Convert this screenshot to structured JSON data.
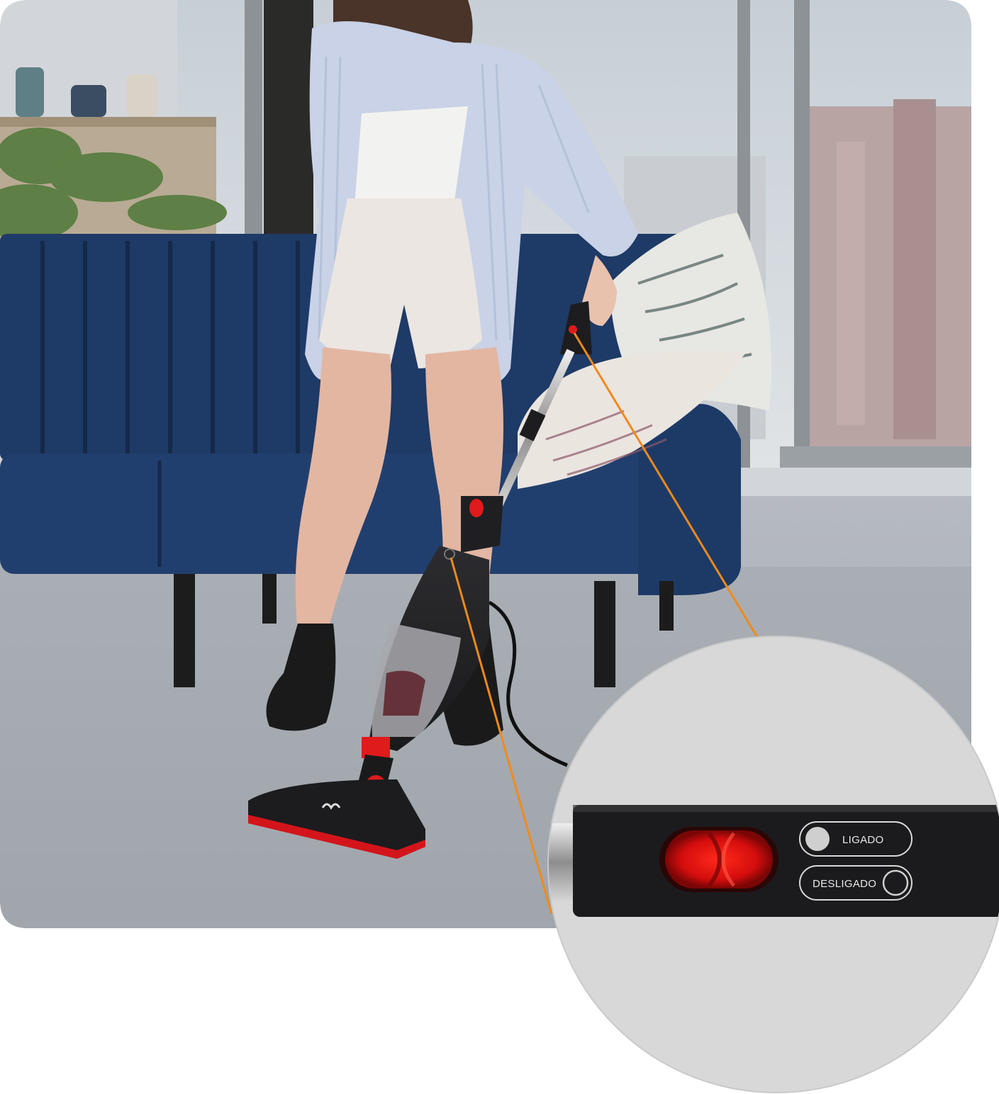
{
  "switch_panel": {
    "on_label": "LIGADO",
    "off_label": "DESLIGADO"
  },
  "colors": {
    "accent_red": "#e01b1b",
    "callout_orange": "#f08a1c",
    "sofa_navy": "#1f3a66",
    "carpet_gray": "#a9aeb4",
    "zoom_bg": "#d8d8d8"
  }
}
